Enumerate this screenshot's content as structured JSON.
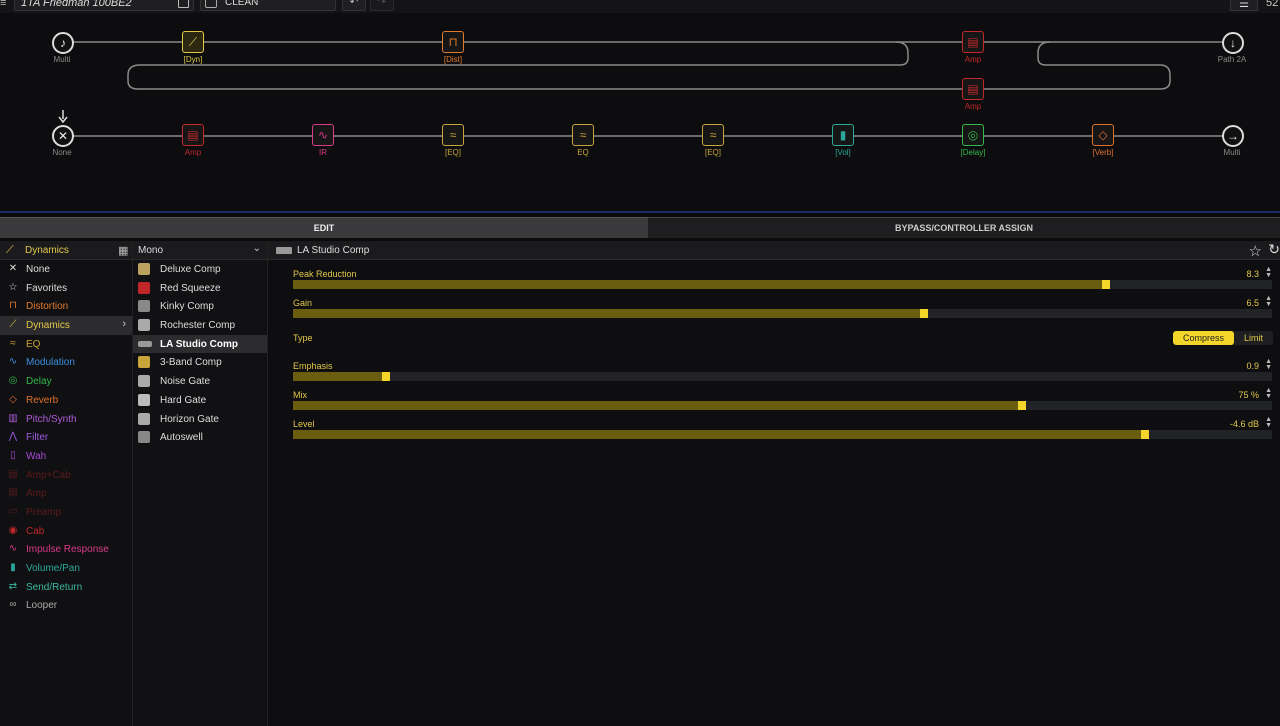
{
  "topbar": {
    "preset_name": "1TA  Friedman 100BE2",
    "snapshot_name": "CLEAN",
    "undo_label": "↶",
    "redo_label": "↷",
    "menu_label": "☰",
    "tempo": "52"
  },
  "signal_flow": {
    "path1": {
      "input_label": "Multi",
      "output_label": "Path 2A",
      "blocks": [
        {
          "label": "[Dyn]",
          "color": "#e2c84a"
        },
        {
          "label": "[Dist]",
          "color": "#e07b2c"
        },
        {
          "label": "Amp",
          "color": "#c0282c"
        },
        {
          "label": "Amp",
          "color": "#c0282c"
        }
      ]
    },
    "path2": {
      "input_label": "None",
      "output_label": "Multi",
      "blocks": [
        {
          "label": "Amp",
          "color": "#c0282c"
        },
        {
          "label": "IR",
          "color": "#d93a8a"
        },
        {
          "label": "[EQ]",
          "color": "#c8a43a"
        },
        {
          "label": "EQ",
          "color": "#c8a43a"
        },
        {
          "label": "[EQ]",
          "color": "#c8a43a"
        },
        {
          "label": "[Vol]",
          "color": "#2aa89a"
        },
        {
          "label": "[Delay]",
          "color": "#33b84a"
        },
        {
          "label": "[Verb]",
          "color": "#e0702c"
        }
      ]
    }
  },
  "tabs": {
    "edit": "EDIT",
    "bypass": "BYPASS/CONTROLLER ASSIGN"
  },
  "categories": {
    "header": "Dynamics",
    "items": [
      {
        "label": "None",
        "color": "#dddddd",
        "icon": "x-icon"
      },
      {
        "label": "Favorites",
        "color": "#dddddd",
        "icon": "star-icon"
      },
      {
        "label": "Distortion",
        "color": "#e07b2c",
        "icon": "distortion-icon"
      },
      {
        "label": "Dynamics",
        "color": "#e2c84a",
        "icon": "dynamics-icon"
      },
      {
        "label": "EQ",
        "color": "#c8a43a",
        "icon": "eq-icon"
      },
      {
        "label": "Modulation",
        "color": "#3a8ee0",
        "icon": "modulation-icon"
      },
      {
        "label": "Delay",
        "color": "#33b84a",
        "icon": "delay-icon"
      },
      {
        "label": "Reverb",
        "color": "#e0702c",
        "icon": "reverb-icon"
      },
      {
        "label": "Pitch/Synth",
        "color": "#b05ad8",
        "icon": "pitch-icon"
      },
      {
        "label": "Filter",
        "color": "#9a5ae0",
        "icon": "filter-icon"
      },
      {
        "label": "Wah",
        "color": "#a64ad8",
        "icon": "wah-icon"
      },
      {
        "label": "Amp+Cab",
        "color": "#5a1a1c",
        "icon": "amp-cab-icon"
      },
      {
        "label": "Amp",
        "color": "#5a1a1c",
        "icon": "amp-icon"
      },
      {
        "label": "Preamp",
        "color": "#5a1a1c",
        "icon": "preamp-icon"
      },
      {
        "label": "Cab",
        "color": "#c0282c",
        "icon": "cab-icon"
      },
      {
        "label": "Impulse Response",
        "color": "#d93a8a",
        "icon": "ir-icon"
      },
      {
        "label": "Volume/Pan",
        "color": "#2aa89a",
        "icon": "volume-icon"
      },
      {
        "label": "Send/Return",
        "color": "#3ab8a0",
        "icon": "send-return-icon"
      },
      {
        "label": "Looper",
        "color": "#aaaaaa",
        "icon": "looper-icon"
      }
    ]
  },
  "models": {
    "header": "Mono",
    "items": [
      {
        "label": "Deluxe Comp"
      },
      {
        "label": "Red Squeeze"
      },
      {
        "label": "Kinky Comp"
      },
      {
        "label": "Rochester Comp"
      },
      {
        "label": "LA Studio Comp"
      },
      {
        "label": "3-Band Comp"
      },
      {
        "label": "Noise Gate"
      },
      {
        "label": "Hard Gate"
      },
      {
        "label": "Horizon Gate"
      },
      {
        "label": "Autoswell"
      }
    ]
  },
  "editor": {
    "title": "LA Studio Comp",
    "params": [
      {
        "name": "Peak Reduction",
        "value": "8.3",
        "fraction": 0.83
      },
      {
        "name": "Gain",
        "value": "6.5",
        "fraction": 0.645
      },
      {
        "name": "Emphasis",
        "value": "0.9",
        "fraction": 0.095
      },
      {
        "name": "Mix",
        "value": "75 %",
        "fraction": 0.745
      },
      {
        "name": "Level",
        "value": "-4.6 dB",
        "fraction": 0.87
      }
    ],
    "type": {
      "name": "Type",
      "options": [
        "Compress",
        "Limit"
      ],
      "selected": "Compress"
    }
  }
}
